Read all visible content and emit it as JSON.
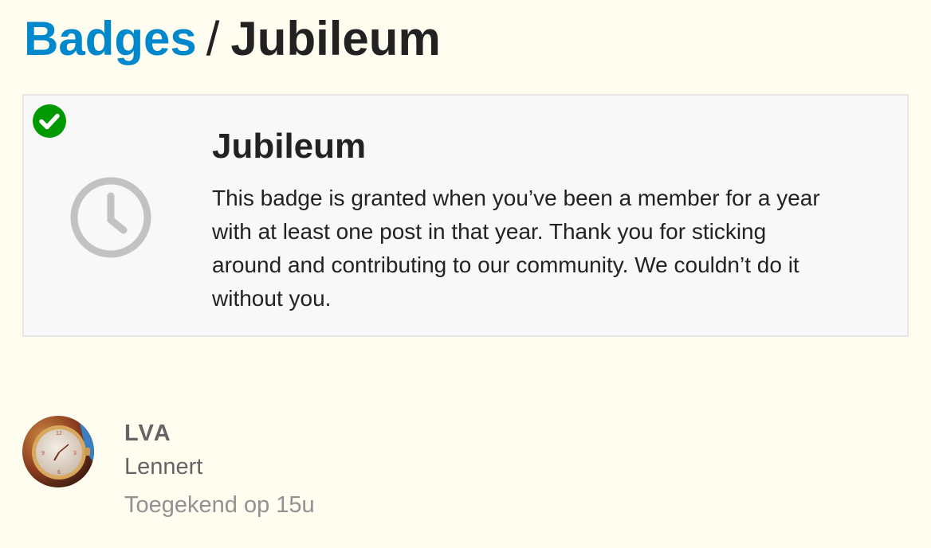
{
  "breadcrumb": {
    "parent": "Badges",
    "separator": "/",
    "current": "Jubileum"
  },
  "badge": {
    "title": "Jubileum",
    "description": "This badge is granted when you’ve been a member for a year with at least one post in that year. Thank you for sticking around and contributing to our community. We couldn’t do it without you.",
    "icon": "clock-icon",
    "granted_icon": "check-circle-icon"
  },
  "grants": [
    {
      "username": "LVA",
      "full_name": "Lennert",
      "granted_at": "Toegekend op 15u",
      "avatar": "watch-avatar"
    }
  ],
  "colors": {
    "link": "#0088cc",
    "granted": "#009900",
    "icon_gray": "#c2c2c2",
    "background": "#fffdf0",
    "card": "#f8f8f8"
  }
}
